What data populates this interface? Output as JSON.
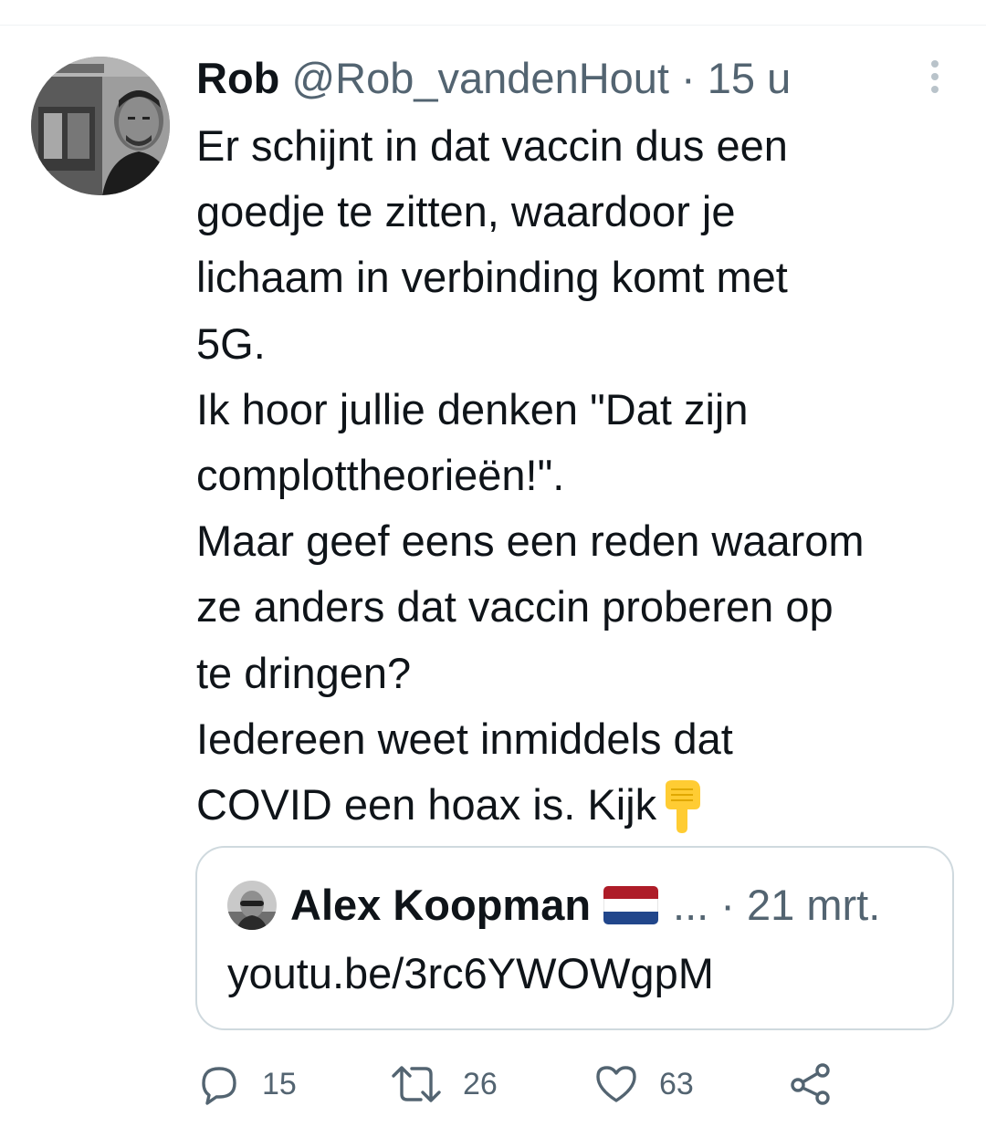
{
  "tweet": {
    "author_name": "Rob",
    "author_handle": "@Rob_vandenHout",
    "separator": "·",
    "time": "15 u",
    "lines": [
      "Er schijnt in dat vaccin dus een",
      "goedje te zitten, waardoor je",
      "lichaam in verbinding komt met",
      "5G.",
      "Ik hoor jullie denken \"Dat zijn",
      "complottheorieën!\".",
      "Maar geef eens een reden waarom",
      "ze anders dat vaccin proberen op",
      "te dringen?",
      "Iedereen weet inmiddels dat",
      "COVID een hoax is. Kijk"
    ],
    "trailing_emoji": "pointing-down-emoji"
  },
  "quoted_tweet": {
    "author_name": "Alex Koopman",
    "flag": "netherlands-flag",
    "ellipsis": "...",
    "separator": "·",
    "date": "21 mrt.",
    "text": "youtu.be/3rc6YWOWgpM"
  },
  "actions": {
    "replies": "15",
    "retweets": "26",
    "likes": "63"
  },
  "icons": {
    "more": "more-vertical-icon",
    "reply": "reply-icon",
    "retweet": "retweet-icon",
    "like": "heart-icon",
    "share": "share-icon"
  },
  "colors": {
    "text": "#0f1419",
    "secondary": "#536471",
    "border": "#cfd9de",
    "icon": "#536471",
    "emoji": "#ffcc33",
    "flag_red": "#ae1c28",
    "flag_white": "#ffffff",
    "flag_blue": "#21468b"
  }
}
